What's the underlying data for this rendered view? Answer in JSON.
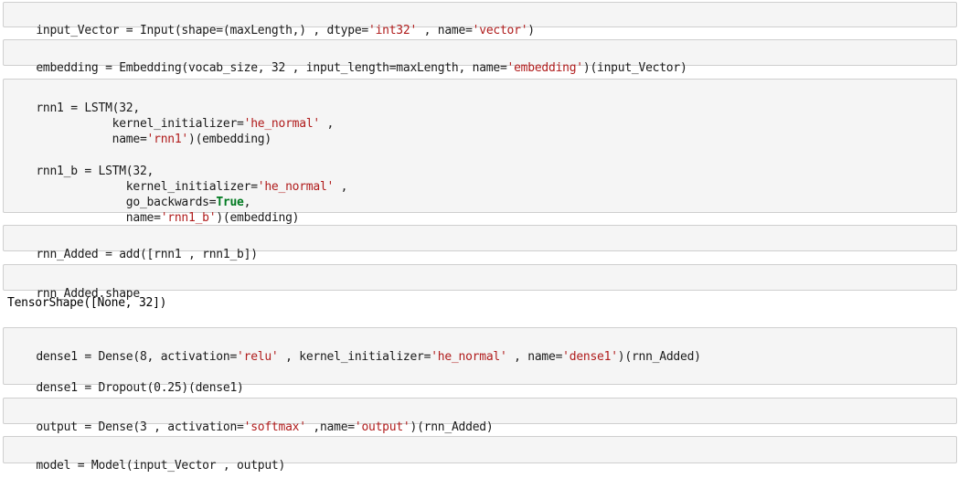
{
  "cells": [
    {
      "lines": [
        [
          "input_Vector = Input(shape=(maxLength,) , dtype=",
          "'int32'",
          " , name=",
          "'vector'",
          ")"
        ]
      ]
    },
    {
      "lines": [
        [
          "embedding = Embedding(vocab_size, 32 , input_length=maxLength, name=",
          "'embedding'",
          ")(input_Vector)"
        ]
      ]
    },
    {
      "lines": [
        [
          "rnn1 = LSTM(32,"
        ],
        [
          "           kernel_initializer=",
          "'he_normal'",
          " ,"
        ],
        [
          "           name=",
          "'rnn1'",
          ")(embedding)"
        ],
        [
          "rnn1_b = LSTM(32,"
        ],
        [
          "             kernel_initializer=",
          "'he_normal'",
          " ,"
        ],
        [
          "             go_backwards=",
          "True",
          ","
        ],
        [
          "             name=",
          "'rnn1_b'",
          ")(embedding)"
        ]
      ]
    },
    {
      "lines": [
        [
          "rnn_Added = add([rnn1 , rnn1_b])"
        ]
      ]
    },
    {
      "lines": [
        [
          "rnn_Added.shape"
        ]
      ]
    },
    {
      "lines": [
        [
          "dense1 = Dense(8, activation=",
          "'relu'",
          " , kernel_initializer=",
          "'he_normal'",
          " , name=",
          "'dense1'",
          ")(rnn_Added)"
        ],
        [
          "dense1 = Dropout(0.25)(dense1)"
        ]
      ]
    },
    {
      "lines": [
        [
          "output = Dense(3 , activation=",
          "'softmax'",
          " ,name=",
          "'output'",
          ")(rnn_Added)"
        ]
      ]
    },
    {
      "lines": [
        [
          "model = Model(input_Vector , output)"
        ]
      ]
    }
  ],
  "outputs": {
    "shape_result": "TensorShape([None, 32])"
  }
}
